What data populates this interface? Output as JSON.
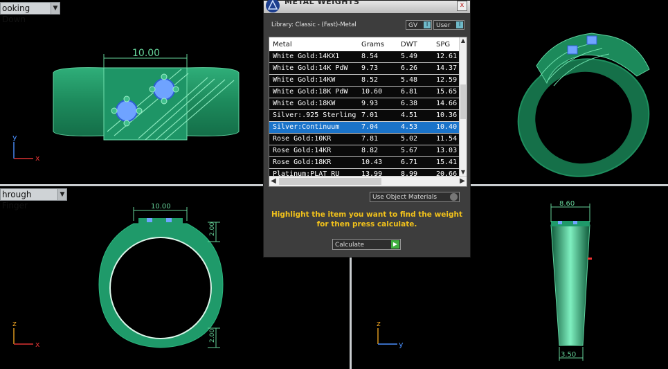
{
  "viewports": {
    "top_left": {
      "label": "ooking Down",
      "dimension": "10.00",
      "axis_up": "y",
      "axis_right": "x"
    },
    "top_right": {},
    "bottom_left": {
      "label": "hrough Finger",
      "dimension_top": "10.00",
      "dimension_side_top": "2.00",
      "dimension_side_bottom": "2.00",
      "axis_up": "z",
      "axis_right": "x"
    },
    "bottom_right": {
      "dimension_top": "8.60",
      "dimension_bottom": "3.50",
      "axis_up": "z",
      "axis_right": "y"
    }
  },
  "dialog": {
    "title": "METAL WEIGHTS",
    "close": "x",
    "library": "Library: Classic - (Fast)-Metal",
    "toggle_gv": "GV",
    "toggle_user": "User",
    "toggle_indicator": "I",
    "columns": [
      "Metal",
      "Grams",
      "DWT",
      "SPG"
    ],
    "rows": [
      {
        "metal": "White Gold:14KX1",
        "grams": "8.54",
        "dwt": "5.49",
        "spg": "12.61",
        "selected": false
      },
      {
        "metal": "White Gold:14K PdW",
        "grams": "9.73",
        "dwt": "6.26",
        "spg": "14.37",
        "selected": false
      },
      {
        "metal": "White Gold:14KW",
        "grams": "8.52",
        "dwt": "5.48",
        "spg": "12.59",
        "selected": false
      },
      {
        "metal": "White Gold:18K PdW",
        "grams": "10.60",
        "dwt": "6.81",
        "spg": "15.65",
        "selected": false
      },
      {
        "metal": "White Gold:18KW",
        "grams": "9.93",
        "dwt": "6.38",
        "spg": "14.66",
        "selected": false
      },
      {
        "metal": "Silver:.925 Sterling",
        "grams": "7.01",
        "dwt": "4.51",
        "spg": "10.36",
        "selected": false
      },
      {
        "metal": "Silver:Continuum",
        "grams": "7.04",
        "dwt": "4.53",
        "spg": "10.40",
        "selected": true
      },
      {
        "metal": "Rose Gold:10KR",
        "grams": "7.81",
        "dwt": "5.02",
        "spg": "11.54",
        "selected": false
      },
      {
        "metal": "Rose Gold:14KR",
        "grams": "8.82",
        "dwt": "5.67",
        "spg": "13.03",
        "selected": false
      },
      {
        "metal": "Rose Gold:18KR",
        "grams": "10.43",
        "dwt": "6.71",
        "spg": "15.41",
        "selected": false
      },
      {
        "metal": "Platinum:PLAT RU",
        "grams": "13.99",
        "dwt": "8.99",
        "spg": "20.66",
        "selected": false
      }
    ],
    "use_object_materials": "Use Object Materials",
    "hint_line1": "Highlight the item you want to find the weight",
    "hint_line2": "for then press calculate.",
    "calculate": "Calculate",
    "calculate_go": "▶"
  },
  "colors": {
    "ring_green": "#1f9a6a",
    "dimension_green": "#66d49a",
    "gem_blue": "#6fa3ff",
    "selected_row": "#1a73c9",
    "hint_yellow": "#f2c21b"
  }
}
